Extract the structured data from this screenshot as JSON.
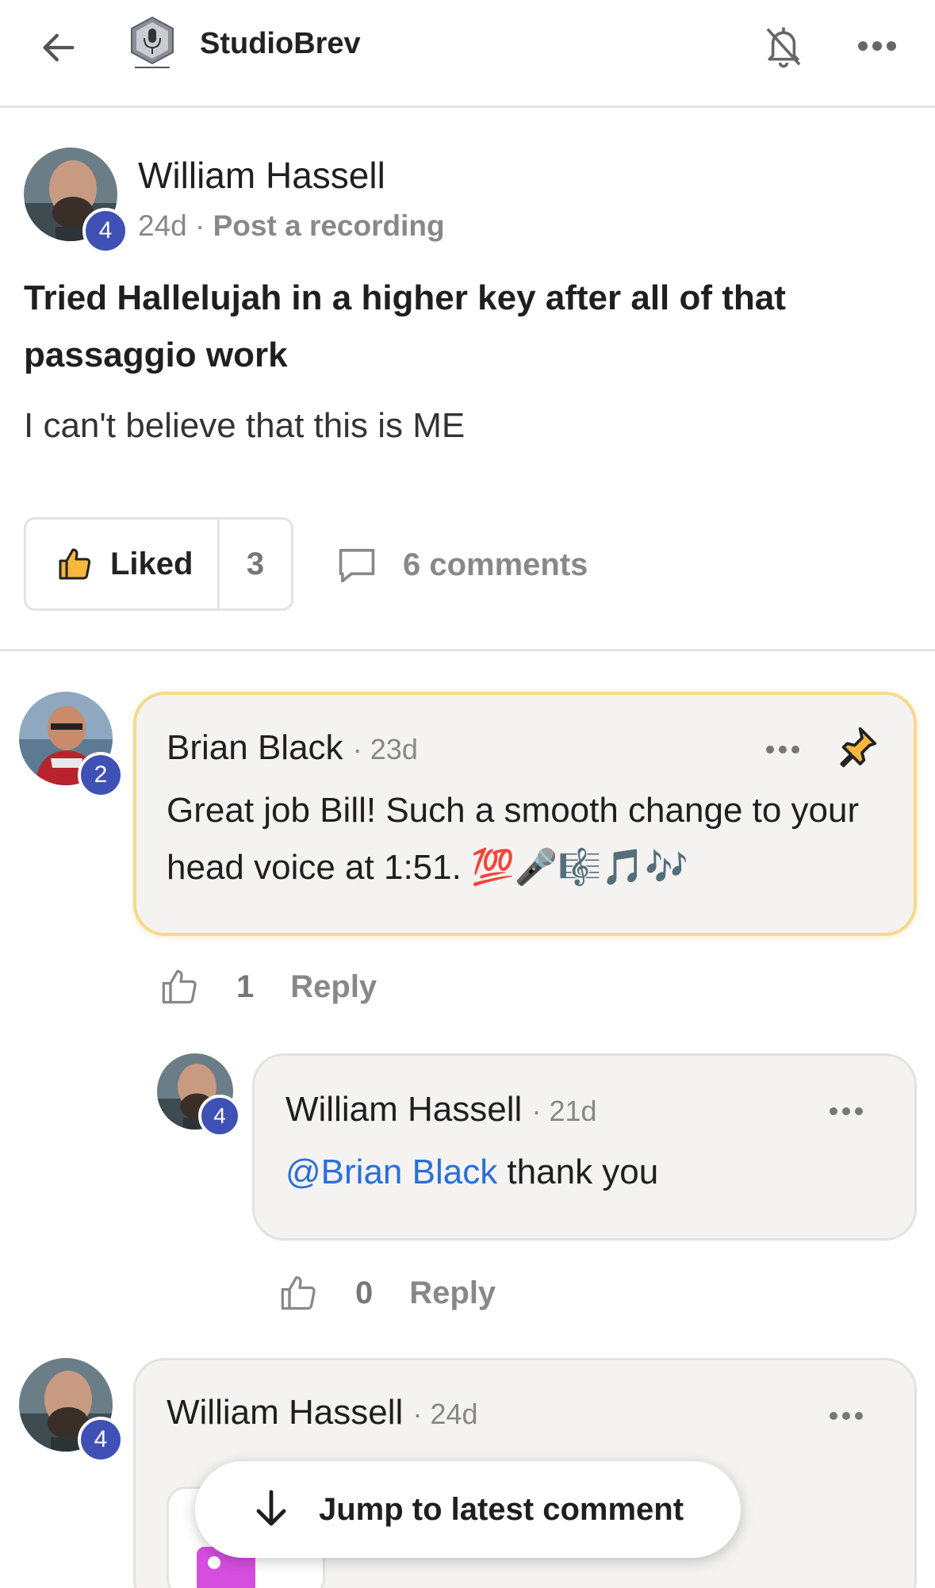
{
  "header": {
    "app_title": "StudioBrev",
    "back_icon": "arrow-left-icon",
    "logo_icon": "microphone-logo-icon",
    "notification_icon": "bell-off-icon",
    "more_icon": "more-horizontal-icon"
  },
  "post": {
    "author": "William Hassell",
    "level": "4",
    "age": "24d",
    "separator": "·",
    "category": "Post a recording",
    "title": "Tried Hallelujah in a higher key after all of that passaggio work",
    "body": "I can't believe that this is ME",
    "like_label": "Liked",
    "like_count": "3",
    "comments_label": "6 comments"
  },
  "comments": [
    {
      "author": "Brian Black",
      "level": "2",
      "age": "· 23d",
      "text": "Great job Bill! Such a smooth change to your head voice at 1:51. 💯🎤🎼🎵🎶",
      "pinned": true,
      "like_count": "1",
      "reply_label": "Reply"
    },
    {
      "author": "William Hassell",
      "level": "4",
      "age": "· 21d",
      "mention": "@Brian Black",
      "text": " thank you",
      "like_count": "0",
      "reply_label": "Reply"
    },
    {
      "author": "William Hassell",
      "level": "4",
      "age": "· 24d"
    }
  ],
  "jump_button": {
    "label": "Jump to latest comment"
  },
  "colors": {
    "level_badge": "#3f51b5",
    "mention": "#2a6fd6",
    "pinned_border": "#f6d98a",
    "muted_text": "#888888"
  }
}
